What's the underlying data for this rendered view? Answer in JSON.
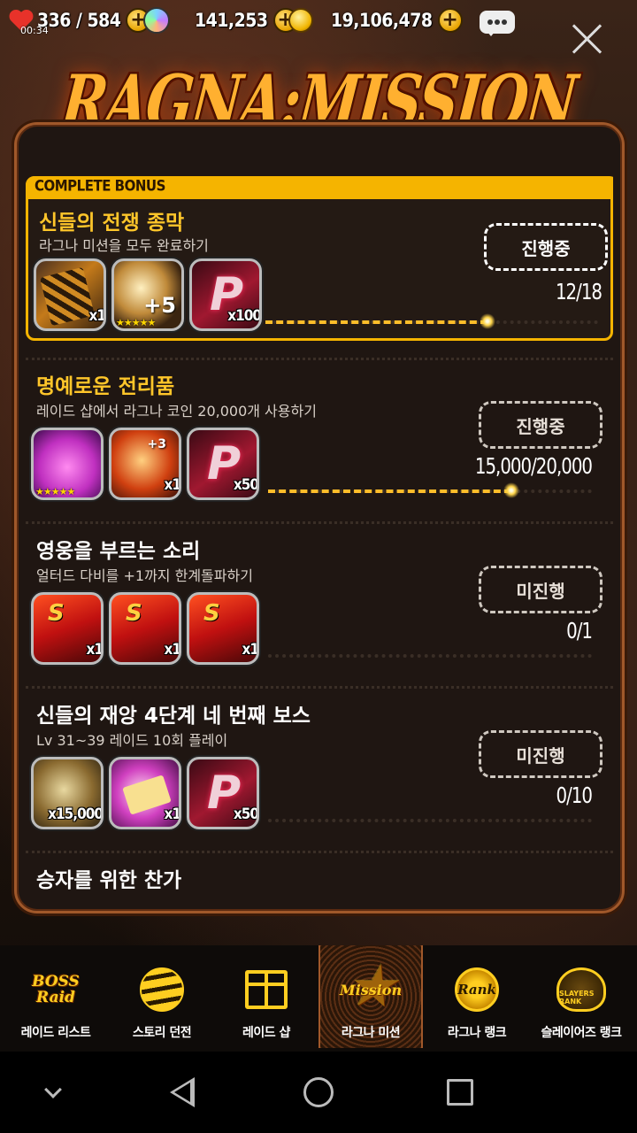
{
  "resources": {
    "stamina": "336 / 584",
    "timer": "00:34",
    "gems": "141,253",
    "gold": "19,106,478"
  },
  "title": "RAGNA:MISSION",
  "missions": [
    {
      "tab": "COMPLETE BONUS",
      "title": "신들의 전쟁 종막",
      "desc": "라그나 미션을 모두 완료하기",
      "status": "진행중",
      "progress": "12/18",
      "fraction": 0.667,
      "rewards": [
        {
          "icon": "card-pack-icon",
          "qty": "x1",
          "stars": ""
        },
        {
          "icon": "enhance-orb-icon",
          "qty": "",
          "stars": "★★★★★",
          "bonus": "+5"
        },
        {
          "icon": "ragna-coin-icon",
          "qty": "x100",
          "stars": ""
        }
      ]
    },
    {
      "title": "명예로운 전리품",
      "desc": "레이드 샵에서 라그나 코인 20,000개 사용하기",
      "status": "진행중",
      "progress": "15,000/20,000",
      "fraction": 0.75,
      "rewards": [
        {
          "icon": "slime-hero-icon",
          "qty": "",
          "stars": "★★★★★"
        },
        {
          "icon": "gear-upgrade-icon",
          "qty": "x1",
          "bonus": "+3"
        },
        {
          "icon": "ragna-coin-icon",
          "qty": "x50"
        }
      ]
    },
    {
      "title": "영웅을 부르는 소리",
      "desc": "얼터드 다비를 +1까지 한계돌파하기",
      "status": "미진행",
      "progress": "0/1",
      "fraction": 0,
      "rewards": [
        {
          "icon": "summon-flag-icon",
          "qty": "x1"
        },
        {
          "icon": "summon-flag-icon",
          "qty": "x1"
        },
        {
          "icon": "summon-flag-icon",
          "qty": "x1"
        }
      ]
    },
    {
      "title": "신들의 재앙 4단계 네 번째 보스",
      "desc": "Lv 31~39 레이드 10회 플레이",
      "status": "미진행",
      "progress": "0/10",
      "fraction": 0,
      "rewards": [
        {
          "icon": "medal-icon",
          "qty": "x15,000"
        },
        {
          "icon": "letter-ticket-icon",
          "qty": "x1"
        },
        {
          "icon": "ragna-coin-icon",
          "qty": "x50"
        }
      ]
    },
    {
      "title": "승자를 위한 찬가"
    }
  ],
  "nav": [
    {
      "label": "레이드 리스트",
      "icon": "boss-raid-icon",
      "icon_text": "BOSS Raid"
    },
    {
      "label": "스토리 던전",
      "icon": "story-dungeon-icon"
    },
    {
      "label": "레이드 샵",
      "icon": "gift-icon"
    },
    {
      "label": "라그나 미션",
      "icon": "mission-star-icon",
      "icon_text": "Mission",
      "active": true
    },
    {
      "label": "라그나 랭크",
      "icon": "rank-globe-icon",
      "icon_text": "Rank"
    },
    {
      "label": "슬레이어즈 랭크",
      "icon": "slayers-rank-icon",
      "icon_text": "SLAYERS RANK"
    }
  ],
  "colors": {
    "accent": "#f5b400",
    "title": "#ffc62a",
    "panel_border": "#a0582a"
  }
}
